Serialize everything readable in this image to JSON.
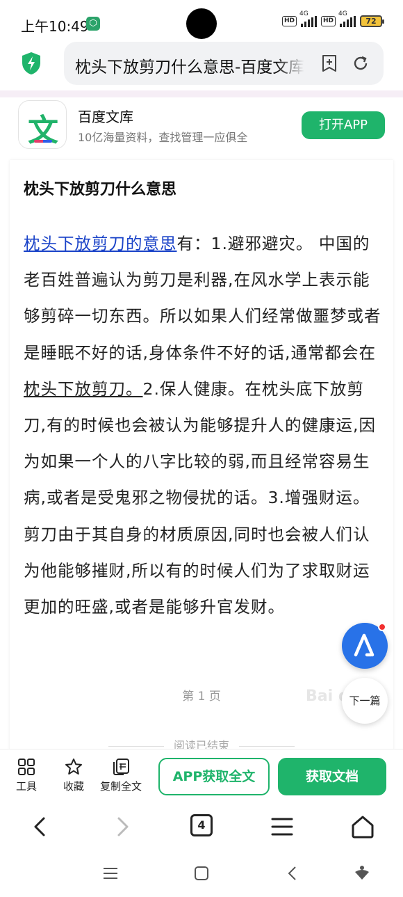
{
  "status_bar": {
    "time": "上午10:49",
    "vpn_icon": "vpn-shield-icon",
    "hd1": "HD",
    "net1": "4G",
    "hd2": "HD",
    "net2": "4G",
    "battery": "72"
  },
  "address_bar": {
    "url_text": "枕头下放剪刀什么意思-百度文库",
    "left_icon": "security-shield-icon",
    "icons": [
      "add-bookmark-icon",
      "refresh-icon"
    ]
  },
  "app_banner": {
    "icon_glyph": "文",
    "name": "百度文库",
    "subtitle": "10亿海量资料，查找管理一应俱全",
    "open_button": "打开APP"
  },
  "article": {
    "title": "枕头下放剪刀什么意思",
    "link_text": "枕头下放剪刀的意思",
    "para_1": "有：1.避邪避灾。 中国的老百姓普遍认为剪刀是利器,在风水学上表示能够剪碎一切东西。所以如果人们经常做噩梦或者是睡眠不好的话,身体条件不好的话,通常都会在",
    "underline_text": "枕头下放剪刀。",
    "para_2": "2.保人健康。在枕头底下放剪刀,有的时候也会被认为能够提升人的健康运,因为如果一个人的八字比较的弱,而且经常容易生病,或者是受鬼邪之物侵扰的话。3.增强财运。 剪刀由于其自身的材质原因,同时也会被人们认为他能够摧财,所以有的时候人们为了求取财运更加的旺盛,或者是能够升官发财。",
    "page_label": "第 1 页",
    "end_label": "阅读已结束",
    "watermark": "Bai du"
  },
  "floating": {
    "ai_icon": "ai-assistant-icon",
    "next_label": "下一篇"
  },
  "toolbar": {
    "tools_label": "工具",
    "favorite_label": "收藏",
    "copy_label": "复制全文",
    "app_full_label": "APP获取全文",
    "get_doc_label": "获取文档"
  },
  "browser_nav": {
    "tab_count": "4"
  },
  "colors": {
    "accent_green": "#1fb46b",
    "link_blue": "#1a43c8"
  }
}
